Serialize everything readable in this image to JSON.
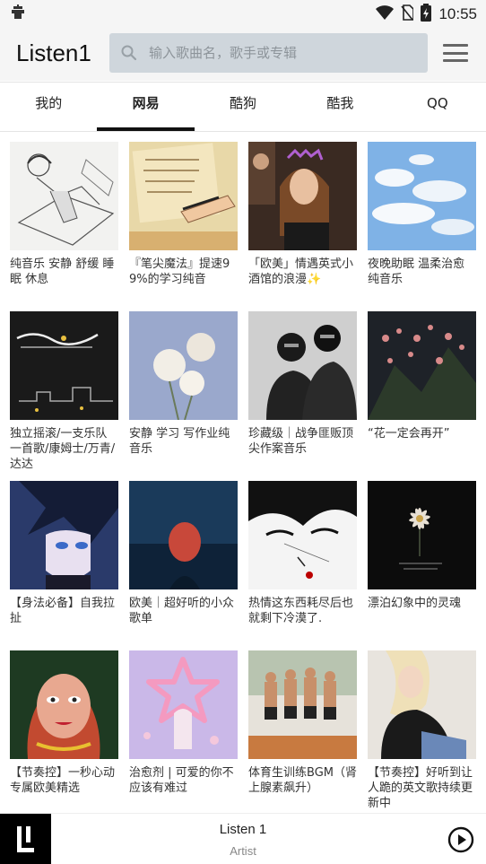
{
  "status": {
    "time": "10:55",
    "left_icon": "bug-icon",
    "icons": [
      "wifi-icon",
      "no-sim-icon",
      "battery-charging-icon"
    ]
  },
  "header": {
    "title": "Listen1",
    "search_placeholder": "输入歌曲名，歌手或专辑"
  },
  "tabs": [
    {
      "label": "我的",
      "active": false
    },
    {
      "label": "网易",
      "active": true
    },
    {
      "label": "酷狗",
      "active": false
    },
    {
      "label": "酷我",
      "active": false
    },
    {
      "label": "QQ",
      "active": false
    }
  ],
  "playlists": [
    {
      "title": "纯音乐 安静 舒缓 睡眠 休息"
    },
    {
      "title": "『笔尖魔法』提速99%的学习纯音"
    },
    {
      "title": "「欧美」情遇英式小酒馆的浪漫✨"
    },
    {
      "title": "夜晚助眠 温柔治愈纯音乐"
    },
    {
      "title": "独立摇滚/一支乐队一首歌/康姆士/万青/达达"
    },
    {
      "title": "安静 学习 写作业纯音乐"
    },
    {
      "title": "珍藏级｜战争匪贩顶尖作案音乐"
    },
    {
      "title": "“花一定会再开”"
    },
    {
      "title": "【身法必备】自我拉扯"
    },
    {
      "title": "欧美｜超好听的小众歌单"
    },
    {
      "title": "热情这东西耗尽后也就剩下冷漠了."
    },
    {
      "title": "漂泊幻象中的灵魂"
    },
    {
      "title": "【节奏控】一秒心动专属欧美精选"
    },
    {
      "title": "治愈剂 | 可爱的你不应该有难过"
    },
    {
      "title": "体育生训练BGM（肾上腺素飙升）"
    },
    {
      "title": "【节奏控】好听到让人跪的英文歌持续更新中"
    }
  ],
  "player": {
    "title": "Listen 1",
    "artist": "Artist",
    "logo_icon": "listen1-logo-icon",
    "play_icon": "play-circle-icon"
  }
}
